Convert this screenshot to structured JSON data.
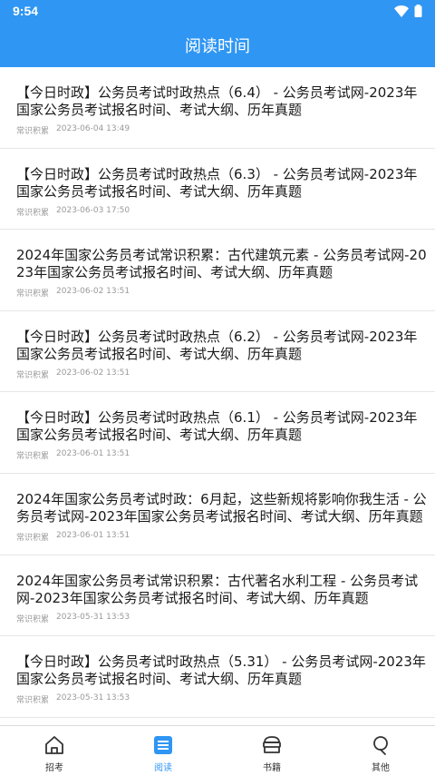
{
  "status": {
    "time": "9:54"
  },
  "header": {
    "title": "阅读时间"
  },
  "colors": {
    "accent": "#2f96f3",
    "text": "#1a1a1a",
    "meta": "#9a9a9a"
  },
  "articles": [
    {
      "title": "【今日时政】公务员考试时政热点（6.4） - 公务员考试网-2023年国家公务员考试报名时间、考试大纲、历年真题",
      "category": "常识积累",
      "date": "2023-06-04 13:49"
    },
    {
      "title": "【今日时政】公务员考试时政热点（6.3） - 公务员考试网-2023年国家公务员考试报名时间、考试大纲、历年真题",
      "category": "常识积累",
      "date": "2023-06-03 17:50"
    },
    {
      "title": "2024年国家公务员考试常识积累：古代建筑元素 - 公务员考试网-2023年国家公务员考试报名时间、考试大纲、历年真题",
      "category": "常识积累",
      "date": "2023-06-02 13:51"
    },
    {
      "title": "【今日时政】公务员考试时政热点（6.2） - 公务员考试网-2023年国家公务员考试报名时间、考试大纲、历年真题",
      "category": "常识积累",
      "date": "2023-06-02 13:51"
    },
    {
      "title": "【今日时政】公务员考试时政热点（6.1） - 公务员考试网-2023年国家公务员考试报名时间、考试大纲、历年真题",
      "category": "常识积累",
      "date": "2023-06-01 13:51"
    },
    {
      "title": "2024年国家公务员考试时政：6月起，这些新规将影响你我生活 - 公务员考试网-2023年国家公务员考试报名时间、考试大纲、历年真题",
      "category": "常识积累",
      "date": "2023-06-01 13:51"
    },
    {
      "title": "2024年国家公务员考试常识积累：古代著名水利工程 - 公务员考试网-2023年国家公务员考试报名时间、考试大纲、历年真题",
      "category": "常识积累",
      "date": "2023-05-31 13:53"
    },
    {
      "title": "【今日时政】公务员考试时政热点（5.31） - 公务员考试网-2023年国家公务员考试报名时间、考试大纲、历年真题",
      "category": "常识积累",
      "date": "2023-05-31 13:53"
    }
  ],
  "tabs": [
    {
      "label": "招考",
      "icon": "home-icon",
      "active": false
    },
    {
      "label": "阅读",
      "icon": "reading-icon",
      "active": true
    },
    {
      "label": "书籍",
      "icon": "books-icon",
      "active": false
    },
    {
      "label": "其他",
      "icon": "profile-icon",
      "active": false
    }
  ]
}
